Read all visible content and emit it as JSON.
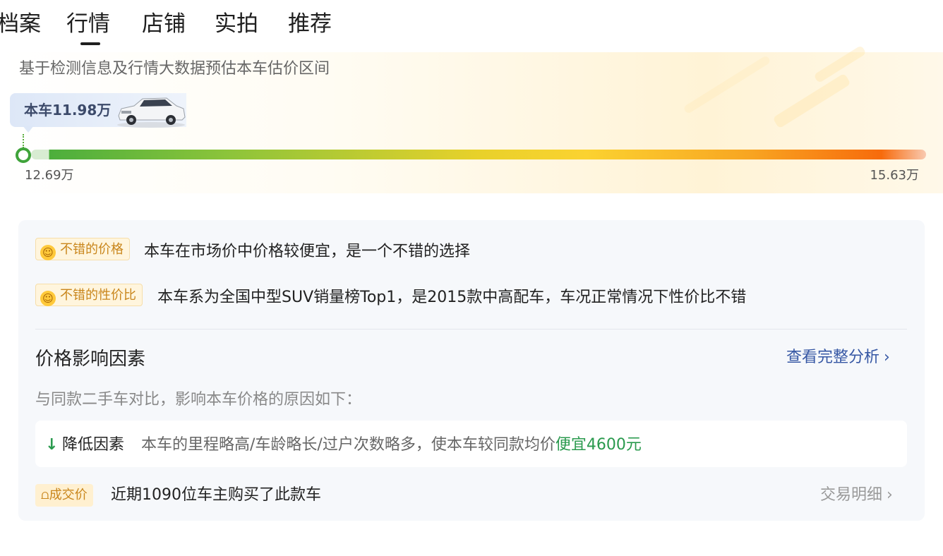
{
  "tabs": [
    {
      "label": "档案",
      "active": false
    },
    {
      "label": "行情",
      "active": true
    },
    {
      "label": "店铺",
      "active": false
    },
    {
      "label": "实拍",
      "active": false
    },
    {
      "label": "推荐",
      "active": false
    }
  ],
  "estimate": {
    "subtitle": "基于检测信息及行情大数据预估本车估价区间",
    "this_car_label": "本车11.98万",
    "range_min": "12.69万",
    "range_max": "15.63万"
  },
  "highlights": [
    {
      "tag": "不错的价格",
      "text": "本车在市场价中价格较便宜，是一个不错的选择"
    },
    {
      "tag": "不错的性价比",
      "text": "本车系为全国中型SUV销量榜Top1，是2015款中高配车，车况正常情况下性价比不错"
    }
  ],
  "factors": {
    "title": "价格影响因素",
    "link": "查看完整分析",
    "compare_text": "与同款二手车对比，影响本车价格的原因如下：",
    "down_label": "降低因素",
    "down_desc": "本车的里程略高/车龄略长/过户次数略多，使本车较同款均价",
    "down_amount": "便宜4600元"
  },
  "deal": {
    "tag": "成交价",
    "text": "近期1090位车主购买了此款车",
    "link": "交易明细"
  },
  "colors": {
    "accent_link": "#3657a4",
    "cheap_green": "#2a9a4e",
    "tag_orange": "#c9861c"
  }
}
